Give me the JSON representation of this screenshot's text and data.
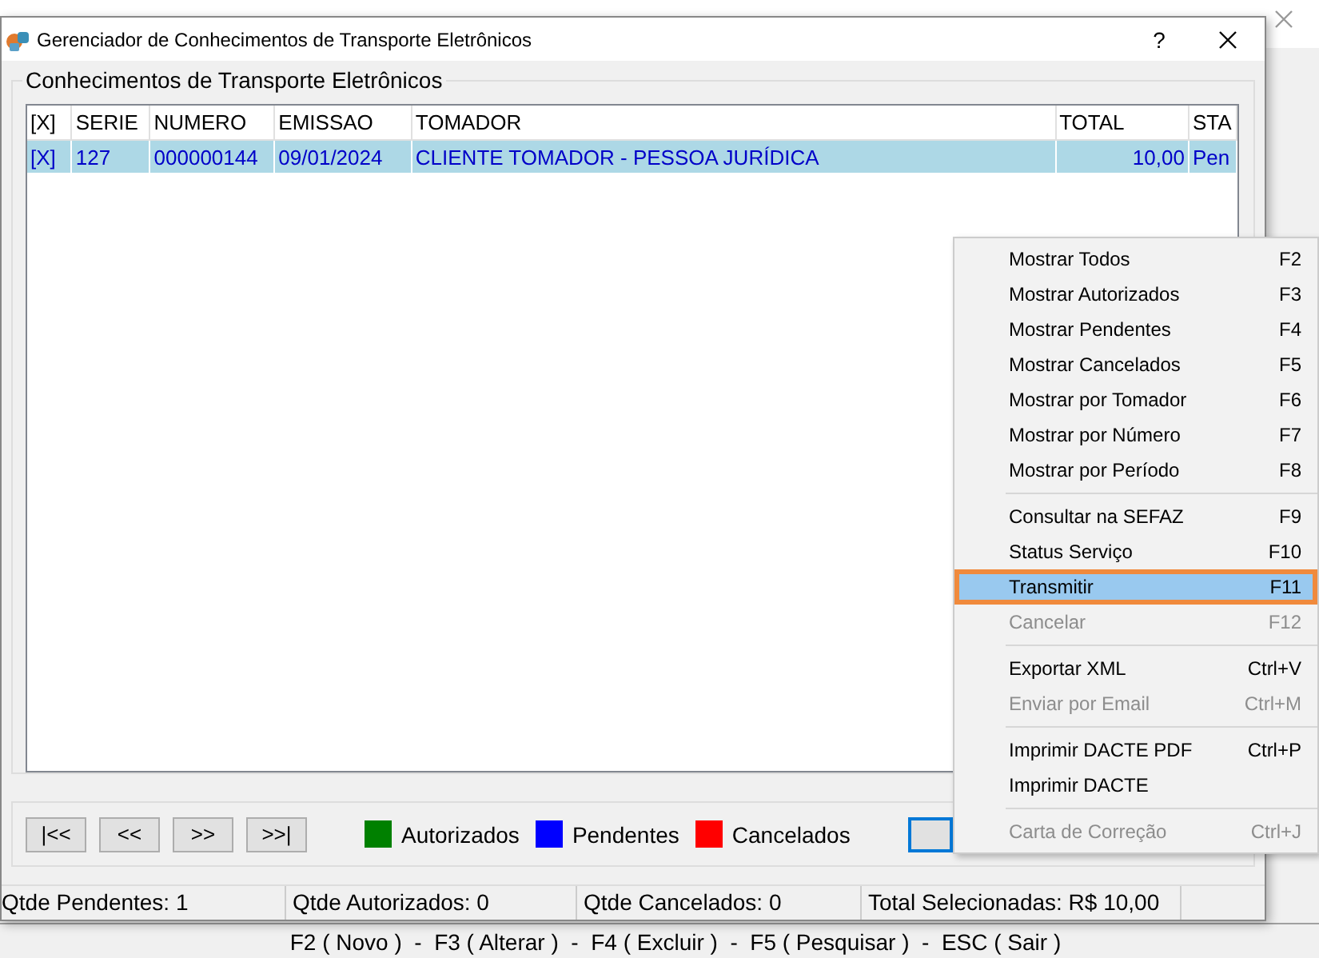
{
  "background_window": {
    "shortcut_bar": "F2 ( Novo )  -  F3 ( Alterar )  -  F4 ( Excluir )  -  F5 ( Pesquisar )  -  ESC ( Sair )"
  },
  "dialog": {
    "title": "Gerenciador de Conhecimentos de Transporte Eletrônicos",
    "help_button": "?",
    "group_title": "Conhecimentos de Transporte Eletrônicos",
    "table": {
      "columns": [
        "[X]",
        "SERIE",
        "NUMERO",
        "EMISSAO",
        "TOMADOR",
        "TOTAL",
        "STA"
      ],
      "rows": [
        {
          "cells": [
            "[X]",
            "127",
            "000000144",
            "09/01/2024",
            "CLIENTE TOMADOR - PESSOA JURÍDICA",
            "10,00",
            "Pen"
          ],
          "selected": true
        }
      ]
    },
    "nav_buttons": [
      "|<<",
      "<<",
      ">>",
      ">>|"
    ],
    "legend": [
      {
        "label": "Autorizados",
        "color": "#008000"
      },
      {
        "label": "Pendentes",
        "color": "#0000ff"
      },
      {
        "label": "Cancelados",
        "color": "#ff0000"
      }
    ],
    "status_bar": [
      "Qtde Pendentes: 1",
      "Qtde Autorizados: 0",
      "Qtde Cancelados: 0",
      "Total Selecionadas: R$ 10,00"
    ]
  },
  "context_menu": {
    "groups": [
      [
        {
          "label": "Mostrar Todos",
          "shortcut": "F2",
          "disabled": false,
          "selected": false
        },
        {
          "label": "Mostrar Autorizados",
          "shortcut": "F3",
          "disabled": false,
          "selected": false
        },
        {
          "label": "Mostrar Pendentes",
          "shortcut": "F4",
          "disabled": false,
          "selected": false
        },
        {
          "label": "Mostrar Cancelados",
          "shortcut": "F5",
          "disabled": false,
          "selected": false
        },
        {
          "label": "Mostrar por Tomador",
          "shortcut": "F6",
          "disabled": false,
          "selected": false
        },
        {
          "label": "Mostrar por Número",
          "shortcut": "F7",
          "disabled": false,
          "selected": false
        },
        {
          "label": "Mostrar por Período",
          "shortcut": "F8",
          "disabled": false,
          "selected": false
        }
      ],
      [
        {
          "label": "Consultar na SEFAZ",
          "shortcut": "F9",
          "disabled": false,
          "selected": false
        },
        {
          "label": "Status Serviço",
          "shortcut": "F10",
          "disabled": false,
          "selected": false
        },
        {
          "label": "Transmitir",
          "shortcut": "F11",
          "disabled": false,
          "selected": true
        },
        {
          "label": "Cancelar",
          "shortcut": "F12",
          "disabled": true,
          "selected": false
        }
      ],
      [
        {
          "label": "Exportar XML",
          "shortcut": "Ctrl+V",
          "disabled": false,
          "selected": false
        },
        {
          "label": "Enviar por Email",
          "shortcut": "Ctrl+M",
          "disabled": true,
          "selected": false
        }
      ],
      [
        {
          "label": "Imprimir DACTE PDF",
          "shortcut": "Ctrl+P",
          "disabled": false,
          "selected": false
        },
        {
          "label": "Imprimir DACTE",
          "disabled": false,
          "selected": false
        }
      ],
      [
        {
          "label": "Carta de Correção",
          "shortcut": "Ctrl+J",
          "disabled": true,
          "selected": false
        }
      ]
    ]
  }
}
